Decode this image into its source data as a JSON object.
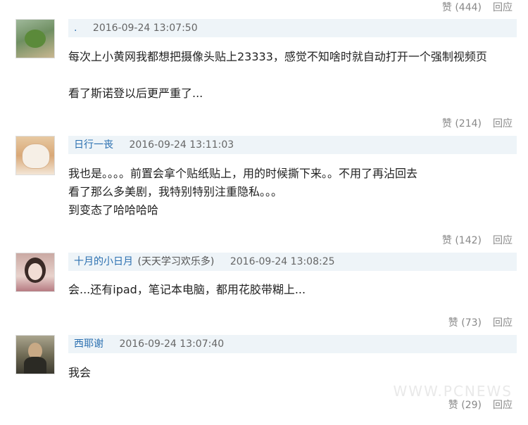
{
  "top_actions": {
    "like": "赞 (444)",
    "reply": "回应"
  },
  "comments": [
    {
      "user": ".",
      "tag": "",
      "time": "2016-09-24 13:07:50",
      "lines": [
        "每次上小黄网我都想把摄像头贴上23333，感觉不知啥时就自动打开一个强制视频页",
        "",
        "看了斯诺登以后更严重了..."
      ],
      "like": "赞 (214)",
      "reply": "回应"
    },
    {
      "user": "日行一丧",
      "tag": "",
      "time": "2016-09-24 13:11:03",
      "lines": [
        "我也是。。。。前置会拿个贴纸贴上，用的时候撕下来。。不用了再沾回去",
        "看了那么多美剧，我特别特别注重隐私。。。",
        "到变态了哈哈哈哈"
      ],
      "like": "赞 (142)",
      "reply": "回应"
    },
    {
      "user": "十月的小日月",
      "tag": "(天天学习欢乐多)",
      "time": "2016-09-24 13:08:25",
      "lines": [
        "会...还有ipad，笔记本电脑，都用花胶带糊上..."
      ],
      "like": "赞 (73)",
      "reply": "回应"
    },
    {
      "user": "西耶谢",
      "tag": "",
      "time": "2016-09-24 13:07:40",
      "lines": [
        "我会"
      ],
      "like": "赞 (29)",
      "reply": "回应"
    }
  ],
  "watermark": "WWW.PCNEWS"
}
